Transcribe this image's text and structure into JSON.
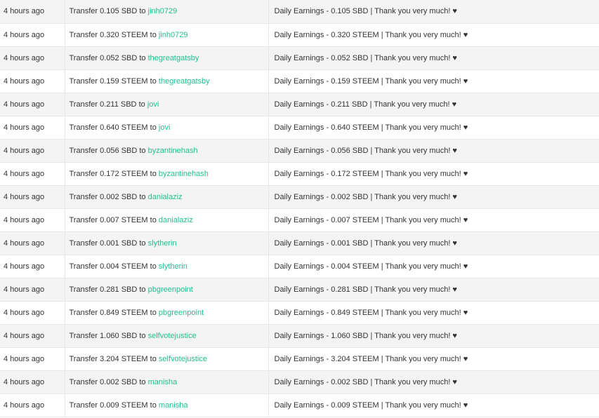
{
  "transfer_word": "Transfer",
  "to_word": "to",
  "rows": [
    {
      "time": "4 hours ago",
      "amount": "0.105 SBD",
      "account": "jinh0729",
      "memo": "Daily Earnings - 0.105 SBD | Thank you very much! ♥"
    },
    {
      "time": "4 hours ago",
      "amount": "0.320 STEEM",
      "account": "jinh0729",
      "memo": "Daily Earnings - 0.320 STEEM | Thank you very much! ♥"
    },
    {
      "time": "4 hours ago",
      "amount": "0.052 SBD",
      "account": "thegreatgatsby",
      "memo": "Daily Earnings - 0.052 SBD | Thank you very much! ♥"
    },
    {
      "time": "4 hours ago",
      "amount": "0.159 STEEM",
      "account": "thegreatgatsby",
      "memo": "Daily Earnings - 0.159 STEEM | Thank you very much! ♥"
    },
    {
      "time": "4 hours ago",
      "amount": "0.211 SBD",
      "account": "jovi",
      "memo": "Daily Earnings - 0.211 SBD | Thank you very much! ♥"
    },
    {
      "time": "4 hours ago",
      "amount": "0.640 STEEM",
      "account": "jovi",
      "memo": "Daily Earnings - 0.640 STEEM | Thank you very much! ♥"
    },
    {
      "time": "4 hours ago",
      "amount": "0.056 SBD",
      "account": "byzantinehash",
      "memo": "Daily Earnings - 0.056 SBD | Thank you very much! ♥"
    },
    {
      "time": "4 hours ago",
      "amount": "0.172 STEEM",
      "account": "byzantinehash",
      "memo": "Daily Earnings - 0.172 STEEM | Thank you very much! ♥"
    },
    {
      "time": "4 hours ago",
      "amount": "0.002 SBD",
      "account": "danialaziz",
      "memo": "Daily Earnings - 0.002 SBD | Thank you very much! ♥"
    },
    {
      "time": "4 hours ago",
      "amount": "0.007 STEEM",
      "account": "danialaziz",
      "memo": "Daily Earnings - 0.007 STEEM | Thank you very much! ♥"
    },
    {
      "time": "4 hours ago",
      "amount": "0.001 SBD",
      "account": "slytherin",
      "memo": "Daily Earnings - 0.001 SBD | Thank you very much! ♥"
    },
    {
      "time": "4 hours ago",
      "amount": "0.004 STEEM",
      "account": "slytherin",
      "memo": "Daily Earnings - 0.004 STEEM | Thank you very much! ♥"
    },
    {
      "time": "4 hours ago",
      "amount": "0.281 SBD",
      "account": "pbgreenpoint",
      "memo": "Daily Earnings - 0.281 SBD | Thank you very much! ♥"
    },
    {
      "time": "4 hours ago",
      "amount": "0.849 STEEM",
      "account": "pbgreenpoint",
      "memo": "Daily Earnings - 0.849 STEEM | Thank you very much! ♥"
    },
    {
      "time": "4 hours ago",
      "amount": "1.060 SBD",
      "account": "selfvotejustice",
      "memo": "Daily Earnings - 1.060 SBD | Thank you very much! ♥"
    },
    {
      "time": "4 hours ago",
      "amount": "3.204 STEEM",
      "account": "selfvotejustice",
      "memo": "Daily Earnings - 3.204 STEEM | Thank you very much! ♥"
    },
    {
      "time": "4 hours ago",
      "amount": "0.002 SBD",
      "account": "manisha",
      "memo": "Daily Earnings - 0.002 SBD | Thank you very much! ♥"
    },
    {
      "time": "4 hours ago",
      "amount": "0.009 STEEM",
      "account": "manisha",
      "memo": "Daily Earnings - 0.009 STEEM | Thank you very much! ♥"
    }
  ],
  "colors": {
    "account_link": "#1fbf8f",
    "row_alt": "#f4f4f4",
    "text": "#333333"
  }
}
